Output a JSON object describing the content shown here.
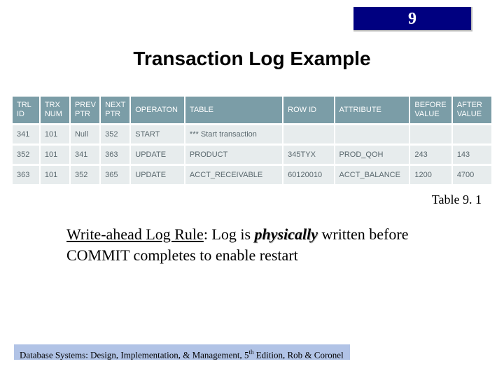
{
  "chapter": "9",
  "title": "Transaction Log Example",
  "table": {
    "headers": [
      "TRL ID",
      "TRX NUM",
      "PREV PTR",
      "NEXT PTR",
      "OPERATON",
      "TABLE",
      "ROW ID",
      "ATTRIBUTE",
      "BEFORE VALUE",
      "AFTER VALUE"
    ],
    "rows": [
      [
        "341",
        "101",
        "Null",
        "352",
        "START",
        "*** Start transaction",
        "",
        "",
        "",
        ""
      ],
      [
        "352",
        "101",
        "341",
        "363",
        "UPDATE",
        "PRODUCT",
        "345TYX",
        "PROD_QOH",
        "243",
        "143"
      ],
      [
        "363",
        "101",
        "352",
        "365",
        "UPDATE",
        "ACCT_RECEIVABLE",
        "60120010",
        "ACCT_BALANCE",
        "1200",
        "4700"
      ]
    ],
    "caption": "Table 9. 1"
  },
  "rule": {
    "lead": "Write-ahead Log Rule",
    "sep": ":  Log is ",
    "emph": "physically",
    "tail": " written before COMMIT completes to enable restart"
  },
  "footer": {
    "pre": "Database Systems: Design, Implementation, & Management, 5",
    "sup": "th",
    "post": " Edition, Rob & Coronel"
  }
}
